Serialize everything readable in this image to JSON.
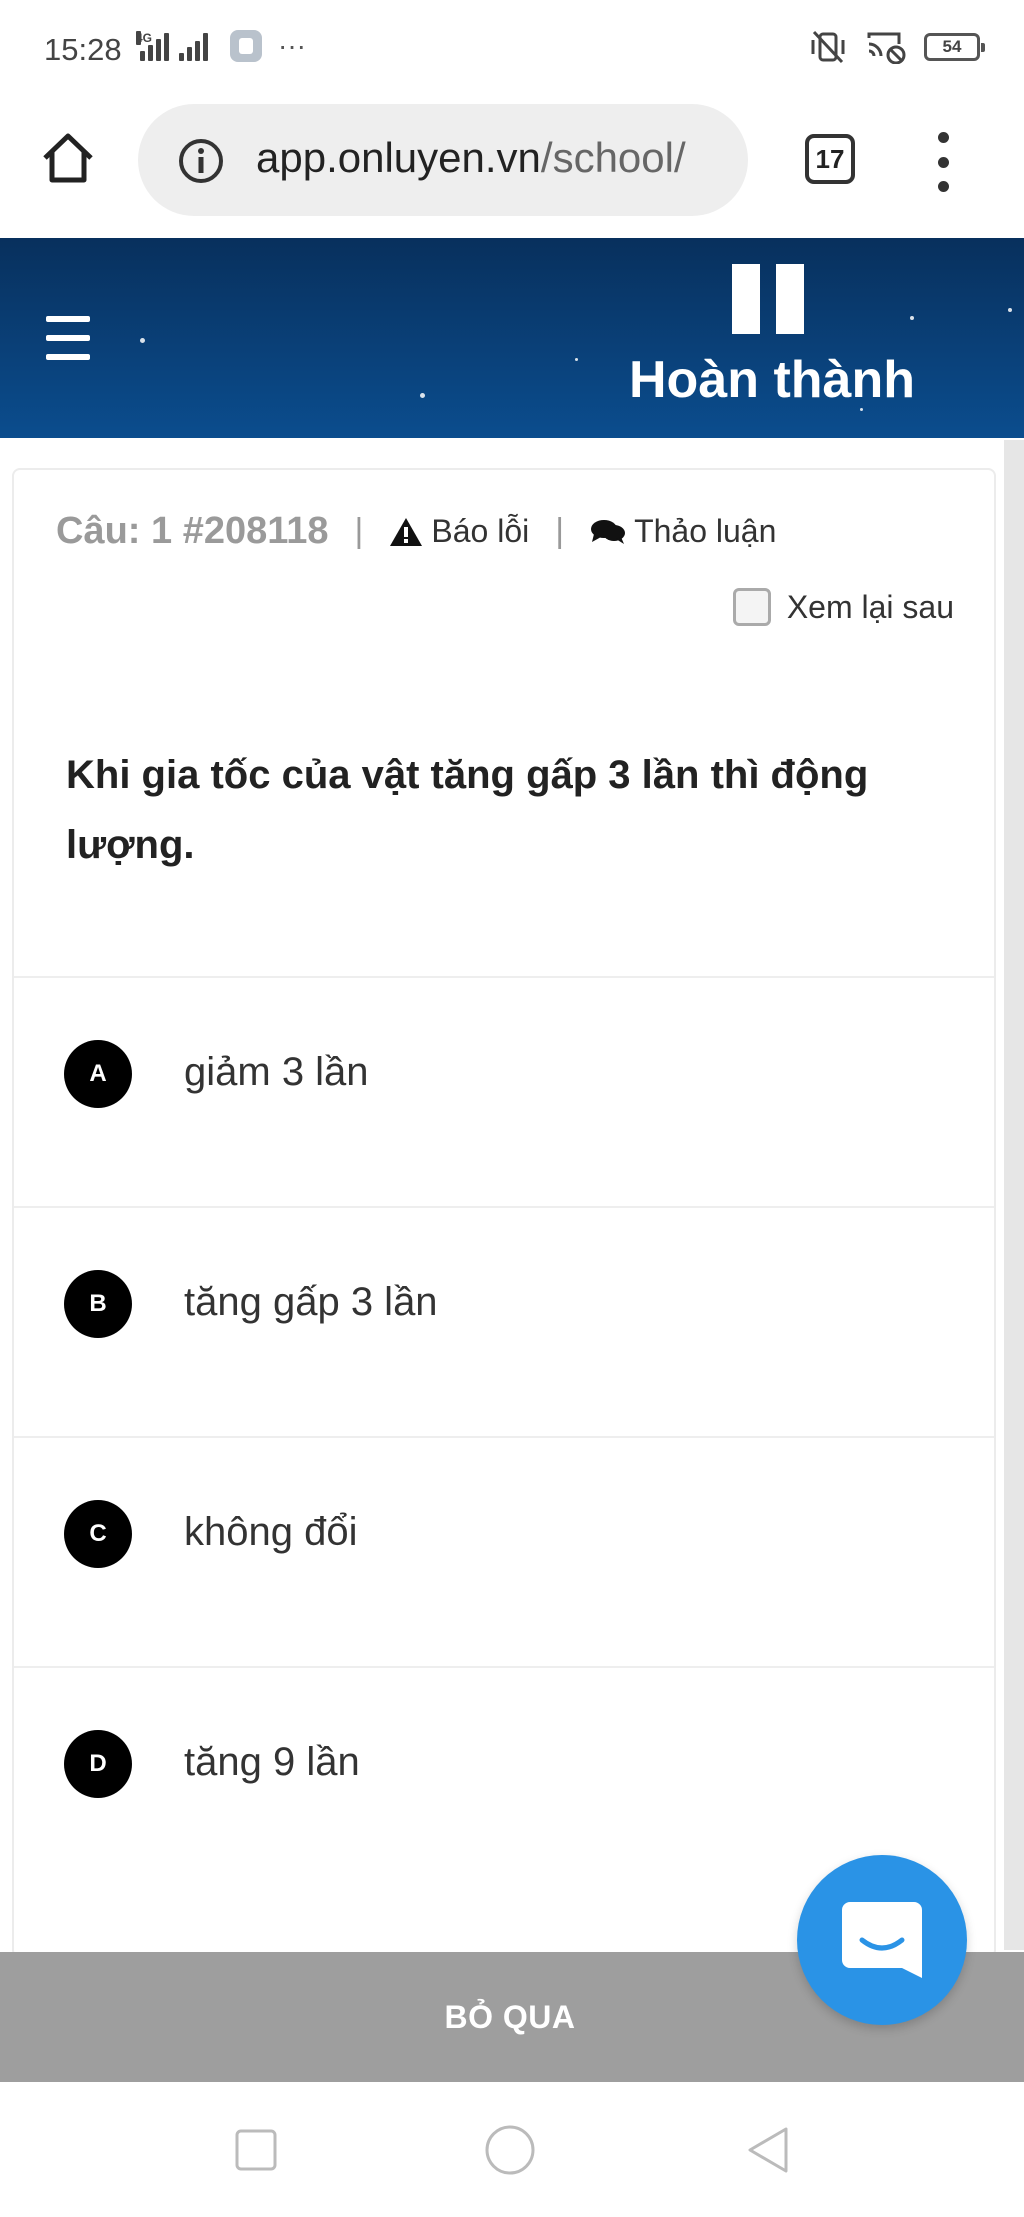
{
  "status_bar": {
    "time": "15:28",
    "network_label": "4G",
    "battery": "54"
  },
  "browser": {
    "url_host": "app.onluyen.vn",
    "url_path": "/school/",
    "tab_count": "17"
  },
  "header": {
    "finish_label": "Hoàn thành"
  },
  "question": {
    "number_label": "Câu: 1 #208118",
    "report_label": "Báo lỗi",
    "discuss_label": "Thảo luận",
    "review_later_label": "Xem lại sau",
    "text": "Khi gia tốc của vật tăng gấp 3 lần thì động lượng."
  },
  "answers": [
    {
      "letter": "A",
      "text": "giảm 3 lần"
    },
    {
      "letter": "B",
      "text": "tăng gấp 3 lần"
    },
    {
      "letter": "C",
      "text": "không đổi"
    },
    {
      "letter": "D",
      "text": "tăng 9 lần"
    }
  ],
  "footer": {
    "skip_label": "BỎ QUA"
  },
  "colors": {
    "header_top": "#08305d",
    "header_bottom": "#0b4d8e",
    "fab": "#2a93e6",
    "skip_bar": "#9e9e9e"
  },
  "icons": {
    "home": "home-icon",
    "info": "info-icon",
    "menu": "more-vert-icon",
    "hamburger": "hamburger-icon",
    "pause": "pause-icon",
    "warning": "warning-icon",
    "chat": "comments-icon",
    "fab": "chat-icon"
  }
}
